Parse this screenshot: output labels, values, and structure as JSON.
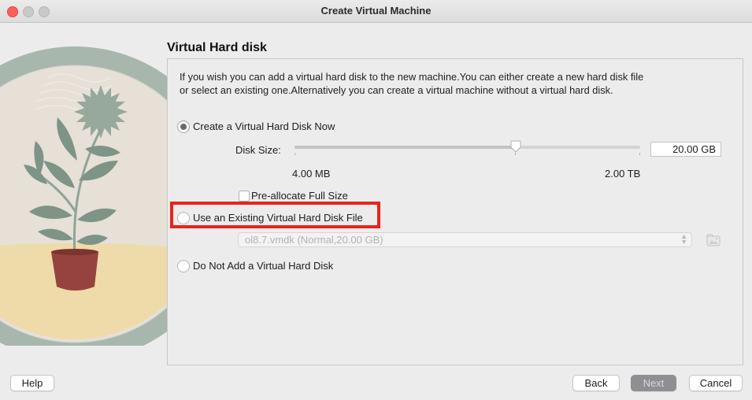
{
  "window": {
    "title": "Create Virtual Machine"
  },
  "page": {
    "heading": "Virtual Hard disk",
    "description": "If you wish you can add a virtual hard disk to the new machine.You can either create a new hard disk file or select an existing one.Alternatively you can create a virtual machine without a virtual hard disk."
  },
  "options": {
    "create_now": {
      "label": "Create a Virtual Hard Disk Now",
      "selected": true
    },
    "use_existing": {
      "label": "Use an Existing Virtual Hard Disk File",
      "selected": false
    },
    "no_disk": {
      "label": "Do Not Add a Virtual Hard Disk",
      "selected": false
    }
  },
  "disk_size": {
    "label": "Disk Size:",
    "value": "20.00 GB",
    "min_label": "4.00 MB",
    "max_label": "2.00 TB",
    "slider_fraction": 0.64
  },
  "preallocate": {
    "label": "Pre-allocate Full Size",
    "checked": false
  },
  "existing_file": {
    "selected": "ol8.7.vmdk (Normal,20.00 GB)"
  },
  "buttons": {
    "help": "Help",
    "back": "Back",
    "next": "Next",
    "cancel": "Cancel"
  },
  "colors": {
    "highlight": "#e8231c",
    "next_disabled": "#8e8e93"
  }
}
